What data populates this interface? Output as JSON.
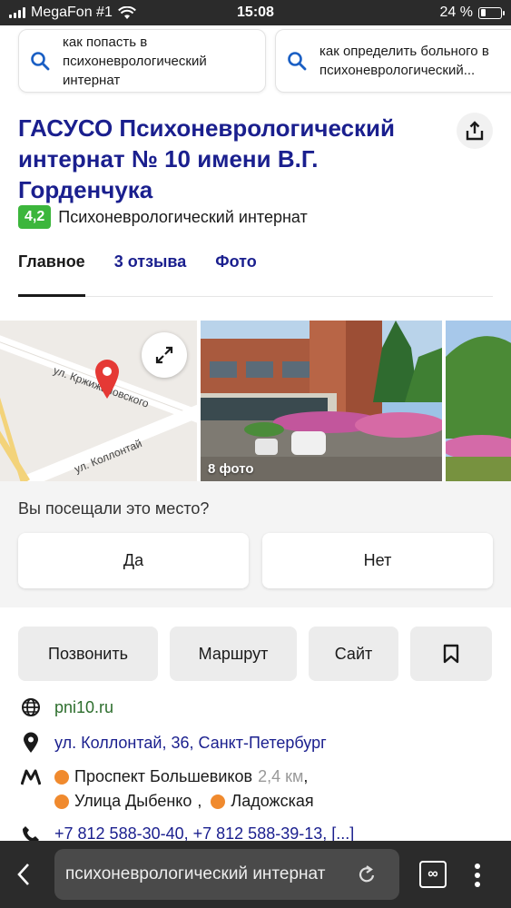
{
  "status_bar": {
    "carrier": "MegaFon #1",
    "time": "15:08",
    "battery": "24 %",
    "battery_level": 0.24
  },
  "suggestions": [
    {
      "text": "как попасть в психоневрологический интернат"
    },
    {
      "text": "как определить больного в психоневрологический..."
    }
  ],
  "place": {
    "title": "ГАСУСО Психоневрологический интернат № 10 имени В.Г. Горденчука",
    "rating": "4,2",
    "category": "Психоневрологический интернат"
  },
  "tabs": [
    {
      "label": "Главное",
      "active": true
    },
    {
      "label": "3 отзыва",
      "active": false
    },
    {
      "label": "Фото",
      "active": false
    }
  ],
  "map": {
    "street1": "ул. Кржижановского",
    "street2": "ул. Коллонтай"
  },
  "gallery": {
    "photo_count": "8 фото"
  },
  "visited": {
    "question": "Вы посещали это место?",
    "yes": "Да",
    "no": "Нет"
  },
  "actions": {
    "call": "Позвонить",
    "route": "Маршрут",
    "site": "Сайт"
  },
  "info": {
    "website": "pni10.ru",
    "address": "ул. Коллонтай, 36, Санкт-Петербург",
    "metro": [
      {
        "name": "Проспект Большевиков",
        "distance": "2,4 км"
      },
      {
        "name": "Улица Дыбенко"
      },
      {
        "name": "Ладожская"
      }
    ],
    "phones": "+7 812 588-30-40, +7 812 588-39-13, [...]"
  },
  "browser": {
    "url_text": "психоневрологический интернат"
  },
  "colors": {
    "title": "#1a1f8e",
    "rating": "#3cb63c",
    "metro_line": "#f08a2e",
    "pin": "#e53935"
  }
}
